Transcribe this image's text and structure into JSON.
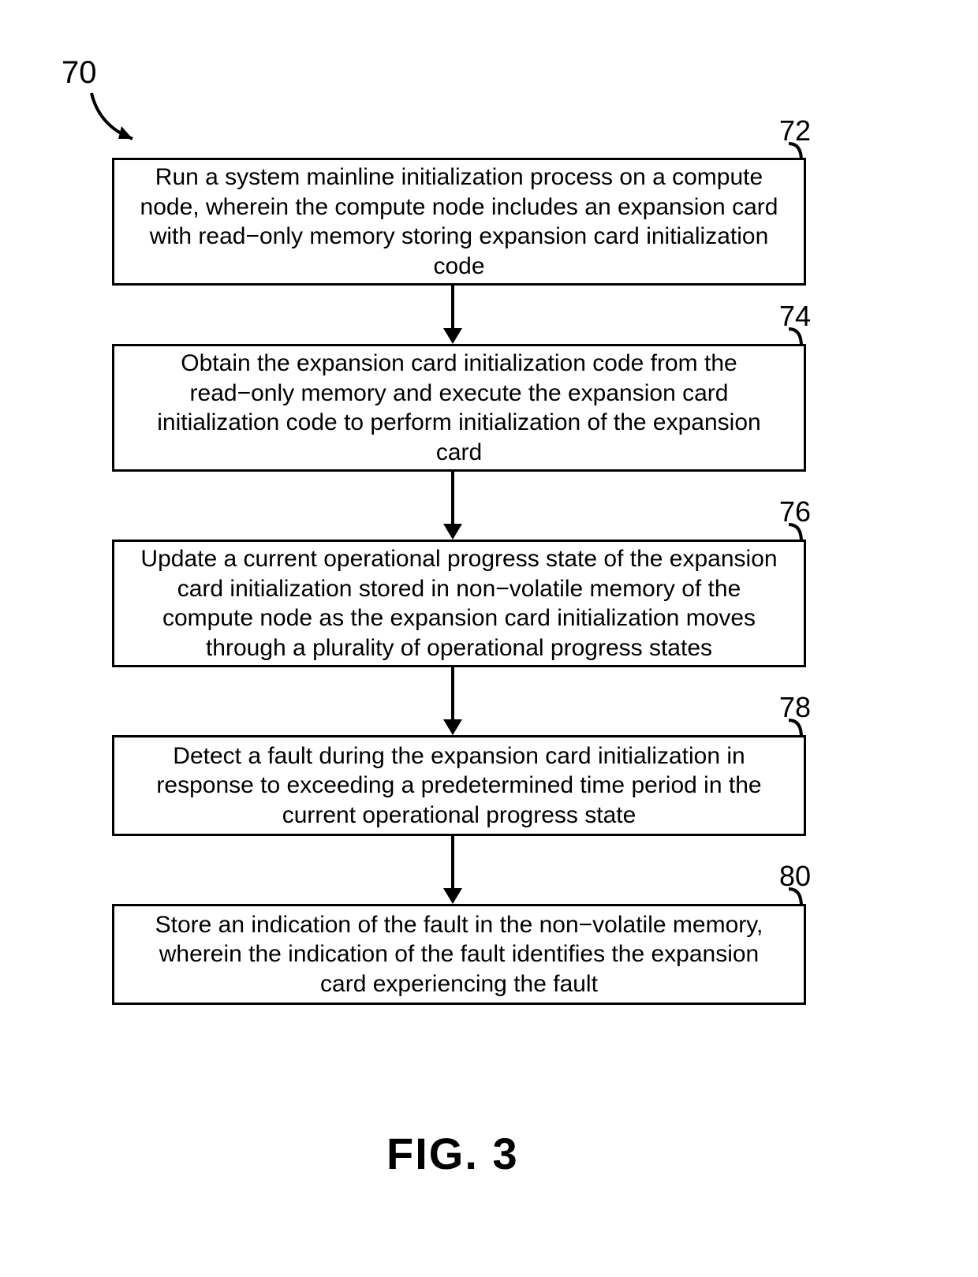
{
  "chart_data": {
    "type": "flowchart",
    "title": "FIG. 3",
    "diagram_id": "70",
    "steps": [
      {
        "id": "72",
        "text": "Run a system mainline initialization process on a compute node, wherein the compute node includes an expansion card with read−only memory storing expansion card initialization code"
      },
      {
        "id": "74",
        "text": "Obtain the expansion card initialization code from the read−only memory and execute the expansion card initialization code to perform initialization of the expansion card"
      },
      {
        "id": "76",
        "text": "Update a current operational progress state of the expansion card initialization stored in non−volatile memory of the compute node as the expansion card initialization moves through a plurality of operational progress states"
      },
      {
        "id": "78",
        "text": "Detect a fault during the expansion card initialization in response to exceeding a predetermined time period in the current operational progress state"
      },
      {
        "id": "80",
        "text": "Store an indication of the fault in the non−volatile memory, wherein the indication of the fault identifies the expansion card experiencing the fault"
      }
    ],
    "edges": [
      {
        "from": "72",
        "to": "74"
      },
      {
        "from": "74",
        "to": "76"
      },
      {
        "from": "76",
        "to": "78"
      },
      {
        "from": "78",
        "to": "80"
      }
    ]
  },
  "figure_caption": "FIG.  3"
}
